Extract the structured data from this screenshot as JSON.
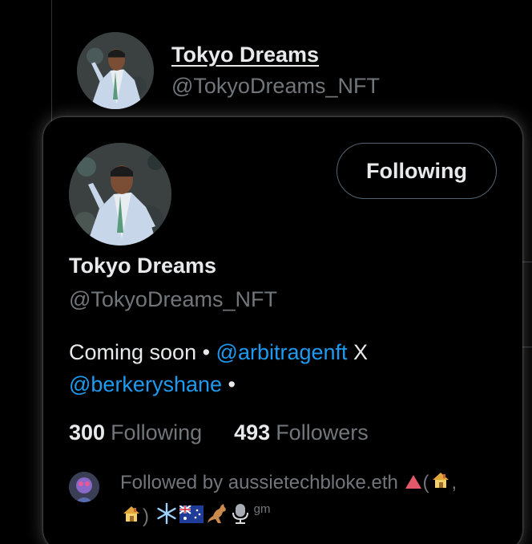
{
  "background": {
    "name": "Tokyo Dreams",
    "handle": "@TokyoDreams_NFT"
  },
  "card": {
    "follow_button_label": "Following",
    "name": "Tokyo Dreams",
    "handle": "@TokyoDreams_NFT",
    "bio": {
      "part1": "Coming soon • ",
      "mention1": "@arbitragenft",
      "part2": " X",
      "mention2": "@berkeryshane",
      "part3": " •"
    },
    "stats": {
      "following_count": "300",
      "following_label": "Following",
      "followers_count": "493",
      "followers_label": "Followers"
    },
    "followed_by": {
      "text": "Followed by aussietechbloke.eth",
      "open_paren": "(",
      "comma": ",",
      "close_paren": ")",
      "gm": "gm"
    }
  },
  "colors": {
    "background": "#000000",
    "text_primary": "#e7e9ea",
    "text_secondary": "#71767b",
    "link": "#1d9bf0",
    "border": "#2f3336"
  }
}
